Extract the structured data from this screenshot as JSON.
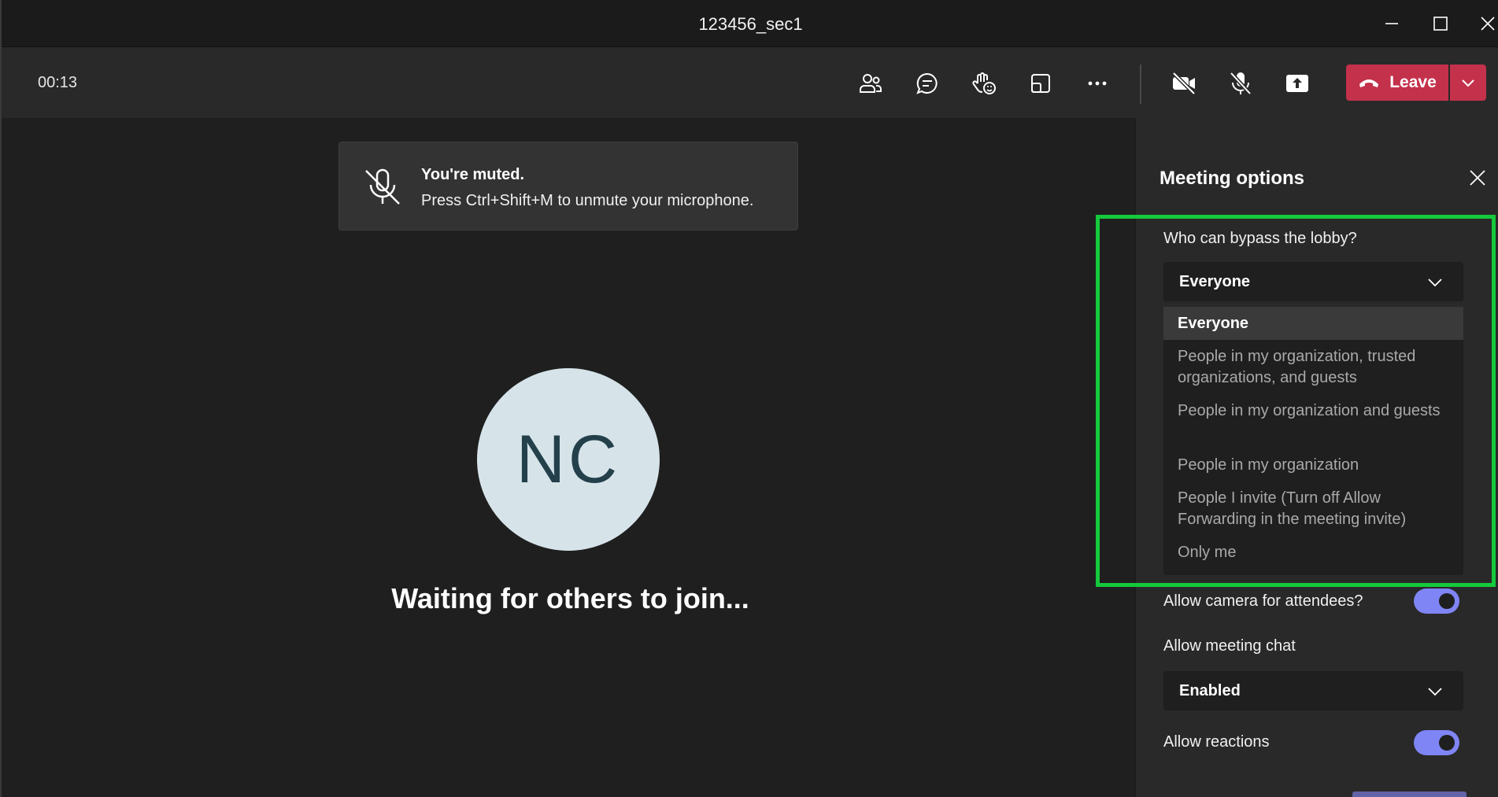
{
  "window": {
    "title": "123456_sec1"
  },
  "toolbar": {
    "timer": "00:13",
    "icons": [
      "people-icon",
      "chat-icon",
      "raise-hand-icon",
      "share-tray-icon",
      "more-icon",
      "camera-off-icon",
      "mic-off-icon",
      "share-screen-icon"
    ],
    "leave_label": "Leave",
    "leave_color": "#c4314b"
  },
  "stage": {
    "muted_title": "You're muted.",
    "muted_hint": "Press Ctrl+Shift+M to unmute your microphone.",
    "avatar_initials": "NC",
    "waiting_text": "Waiting for others to join..."
  },
  "panel": {
    "title": "Meeting options",
    "lobby": {
      "label": "Who can bypass the lobby?",
      "selected": "Everyone",
      "options": [
        "Everyone",
        "People in my organization, trusted organizations, and guests",
        "People in my organization and guests",
        "People in my organization",
        "People I invite (Turn off Allow Forwarding in the meeting invite)",
        "Only me"
      ]
    },
    "camera": {
      "label": "Allow camera for attendees?",
      "enabled": true
    },
    "chat": {
      "label": "Allow meeting chat",
      "selected": "Enabled"
    },
    "reactions": {
      "label": "Allow reactions",
      "enabled": true
    },
    "toggle_color": "#7f85f5",
    "highlight_color": "#14c93c"
  }
}
